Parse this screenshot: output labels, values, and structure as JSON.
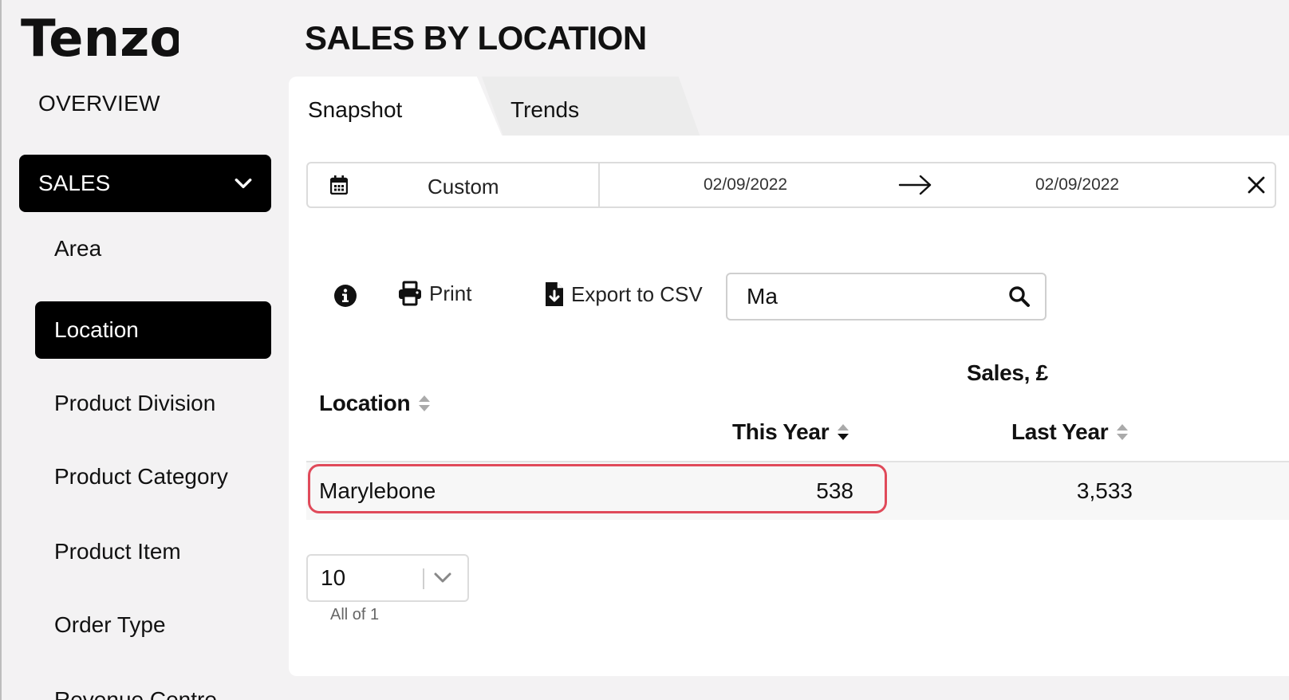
{
  "app": {
    "brand": "Tenzo"
  },
  "page": {
    "title": "SALES BY LOCATION"
  },
  "sidebar": {
    "overview": "OVERVIEW",
    "sales": "SALES",
    "items": [
      {
        "label": "Area",
        "active": false
      },
      {
        "label": "Location",
        "active": true
      },
      {
        "label": "Product Division",
        "active": false
      },
      {
        "label": "Product Category",
        "active": false
      },
      {
        "label": "Product Item",
        "active": false
      },
      {
        "label": "Order Type",
        "active": false
      }
    ],
    "cutoff_item": "Revenue Centre"
  },
  "tabs": [
    {
      "label": "Snapshot",
      "active": true
    },
    {
      "label": "Trends",
      "active": false
    }
  ],
  "date_range": {
    "preset": "Custom",
    "start": "02/09/2022",
    "end": "02/09/2022"
  },
  "toolbar": {
    "print": "Print",
    "export": "Export to CSV",
    "search_value": "Ma"
  },
  "table": {
    "group_header": "Sales, £",
    "columns": [
      "Location",
      "This Year",
      "Last Year"
    ],
    "rows": [
      {
        "location": "Marylebone",
        "this_year": "538",
        "last_year": "3,533"
      }
    ]
  },
  "pagination": {
    "page_size": "10",
    "summary": "All of 1"
  },
  "colors": {
    "background": "#f3f2f3",
    "active": "#000000",
    "highlight": "#e04a5a"
  }
}
